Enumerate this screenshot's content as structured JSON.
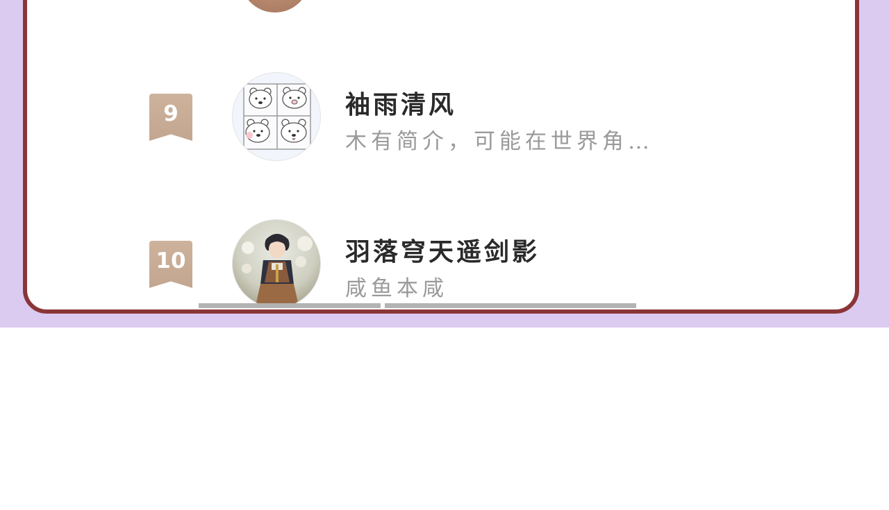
{
  "colors": {
    "background": "#dccbf1",
    "card_border": "#8a3538",
    "card_fill": "#ffffff",
    "rank_ribbon": "#c8ab95",
    "name_text": "#2a2a2a",
    "bio_text": "#9a9a9a",
    "scrollbar": "#b3b3b3"
  },
  "ranking_list": [
    {
      "rank": "9",
      "name": "袖雨清风",
      "bio": "木有简介，可能在世界角…",
      "avatar_icon": "bear-sticker-avatar-icon"
    },
    {
      "rank": "10",
      "name": "羽落穹天遥剑影",
      "bio": "咸鱼本咸",
      "avatar_icon": "anime-character-avatar-icon"
    }
  ]
}
